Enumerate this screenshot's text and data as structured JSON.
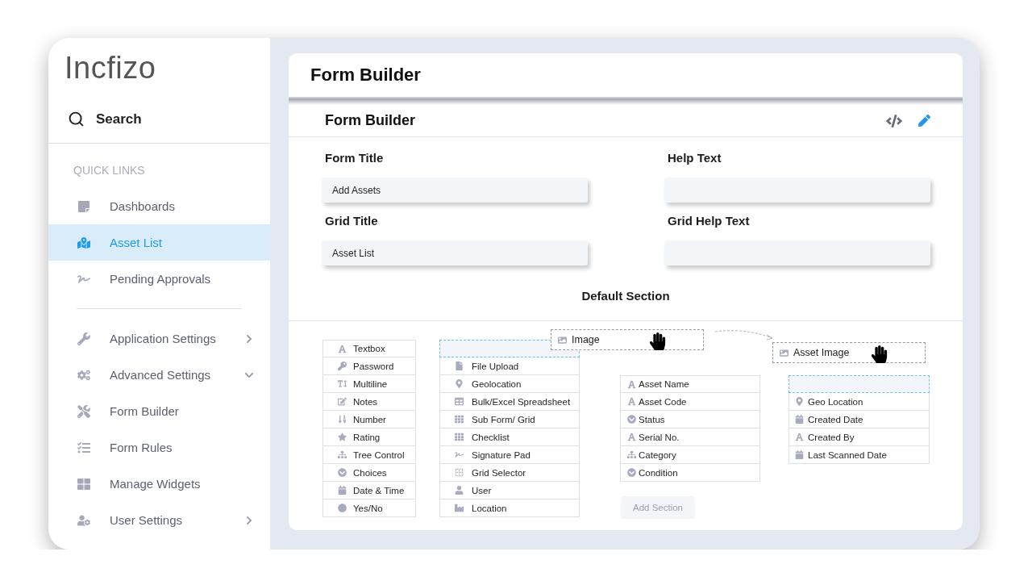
{
  "sidebar": {
    "logo": "Incfizo",
    "search": {
      "label": "Search"
    },
    "quick_links": {
      "heading": "QUICK LINKS",
      "items": [
        {
          "label": "Dashboards",
          "selected": false
        },
        {
          "label": "Asset List",
          "selected": true
        },
        {
          "label": "Pending Approvals",
          "selected": false
        }
      ]
    },
    "items": [
      {
        "label": "Application Settings",
        "selected": false,
        "expanded": false
      },
      {
        "label": "Advanced Settings",
        "selected": false,
        "expanded": true
      },
      {
        "label": "Form Builder",
        "selected": false
      },
      {
        "label": "Form Rules",
        "selected": false
      },
      {
        "label": "Manage Widgets",
        "selected": false
      },
      {
        "label": "User Settings",
        "selected": false,
        "expanded": false
      }
    ]
  },
  "page": {
    "title": "Form Builder"
  },
  "form_builder": {
    "title": "Form Builder",
    "fields": [
      {
        "label": "Form Title",
        "value": "Add Assets"
      },
      {
        "label": "Help Text"
      },
      {
        "label": "Grid Title",
        "value": "Asset List"
      },
      {
        "label": "Grid Help Text"
      }
    ],
    "section": {
      "title": "Default Section",
      "columns": [
        {
          "items": [
            {
              "label": "Textbox",
              "kind": "textbox"
            },
            {
              "label": "Password",
              "kind": "password"
            },
            {
              "label": "Multiline",
              "kind": "multiline"
            },
            {
              "label": "Notes",
              "kind": "notes"
            },
            {
              "label": "Number",
              "kind": "number"
            },
            {
              "label": "Rating",
              "kind": "rating"
            },
            {
              "label": "Tree Control",
              "kind": "tree"
            },
            {
              "label": "Choices",
              "kind": "choices"
            },
            {
              "label": "Date & Time",
              "kind": "date"
            },
            {
              "label": "Yes/No",
              "kind": "toggle"
            }
          ]
        },
        {
          "drag": {
            "label": "Image",
            "kind": "image"
          },
          "items": [
            {
              "label": "File Upload",
              "kind": "file"
            },
            {
              "label": "Geolocation",
              "kind": "geolocation"
            },
            {
              "label": "Bulk/Excel Spreadsheet",
              "kind": "spreadsheet"
            },
            {
              "label": "Sub Form/ Grid",
              "kind": "subform"
            },
            {
              "label": "Checklist",
              "kind": "checklist"
            },
            {
              "label": "Signature Pad",
              "kind": "signature"
            },
            {
              "label": "Grid Selector",
              "kind": "gridselector"
            },
            {
              "label": "User",
              "kind": "user"
            },
            {
              "label": "Location",
              "kind": "location"
            }
          ]
        },
        {
          "items": [
            {
              "label": "Asset Name",
              "kind": "textbox"
            },
            {
              "label": "Asset Code",
              "kind": "textbox"
            },
            {
              "label": "Status",
              "kind": "choices"
            },
            {
              "label": "Serial No.",
              "kind": "textbox"
            },
            {
              "label": "Category",
              "kind": "tree"
            },
            {
              "label": "Condition",
              "kind": "choices"
            }
          ],
          "button": "Add Section"
        },
        {
          "drag": {
            "label": "Asset Image",
            "kind": "image"
          },
          "items": [
            {
              "label": "Geo Location",
              "kind": "geolocation"
            },
            {
              "label": "Created Date",
              "kind": "date"
            },
            {
              "label": "Created By",
              "kind": "textbox"
            },
            {
              "label": "Last Scanned Date",
              "kind": "date"
            }
          ]
        }
      ]
    }
  }
}
